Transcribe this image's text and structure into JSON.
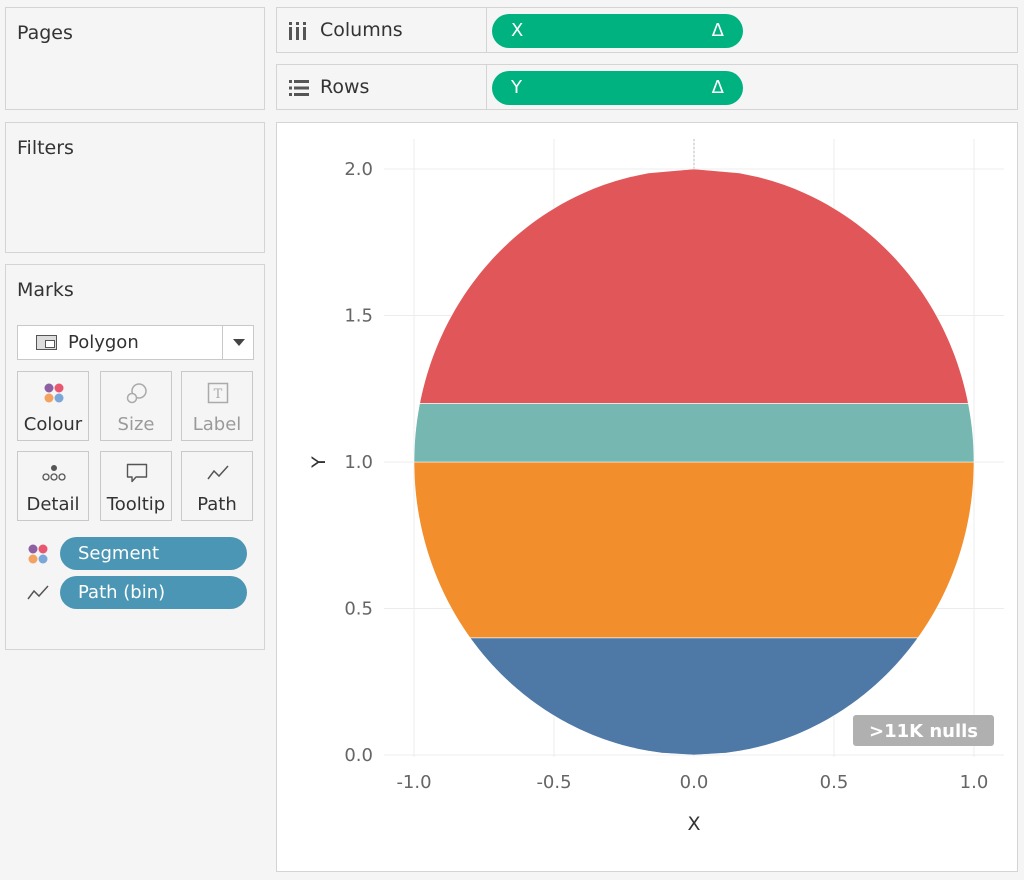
{
  "pages": {
    "title": "Pages"
  },
  "filters": {
    "title": "Filters"
  },
  "marks": {
    "title": "Marks",
    "mark_type": "Polygon",
    "buttons": [
      {
        "label": "Colour",
        "icon": "colour-dots-icon",
        "enabled": true
      },
      {
        "label": "Size",
        "icon": "size-circles-icon",
        "enabled": false
      },
      {
        "label": "Label",
        "icon": "label-t-icon",
        "enabled": false
      },
      {
        "label": "Detail",
        "icon": "detail-dots-icon",
        "enabled": true
      },
      {
        "label": "Tooltip",
        "icon": "speech-bubble-icon",
        "enabled": true
      },
      {
        "label": "Path",
        "icon": "path-line-icon",
        "enabled": true
      }
    ],
    "fields": [
      {
        "label": "Segment",
        "icon": "colour-dots-icon"
      },
      {
        "label": "Path (bin)",
        "icon": "path-line-icon"
      }
    ]
  },
  "shelves": {
    "columns": {
      "label": "Columns",
      "icon": "columns-icon",
      "pill": "X",
      "pill_symbol": "Δ"
    },
    "rows": {
      "label": "Rows",
      "icon": "rows-icon",
      "pill": "Y",
      "pill_symbol": "Δ"
    }
  },
  "chart_data": {
    "type": "area",
    "xlabel": "X",
    "ylabel": "Y",
    "xlim": [
      -1.0,
      1.0
    ],
    "ylim": [
      0.0,
      2.0
    ],
    "xticks": [
      "-1.0",
      "-0.5",
      "0.0",
      "0.5",
      "1.0"
    ],
    "yticks": [
      "0.0",
      "0.5",
      "1.0",
      "1.5",
      "2.0"
    ],
    "grid": true,
    "shape": "circle",
    "circle": {
      "center_x": 0.0,
      "center_y": 1.0,
      "radius": 1.0
    },
    "segments": [
      {
        "y_from": 0.0,
        "y_to": 0.4,
        "color": "#4e79a7"
      },
      {
        "y_from": 0.4,
        "y_to": 1.0,
        "color": "#f28e2b"
      },
      {
        "y_from": 1.0,
        "y_to": 1.2,
        "color": "#76b7b2"
      },
      {
        "y_from": 1.2,
        "y_to": 2.0,
        "color": "#e15759"
      }
    ],
    "null_indicator": ">11K nulls"
  }
}
